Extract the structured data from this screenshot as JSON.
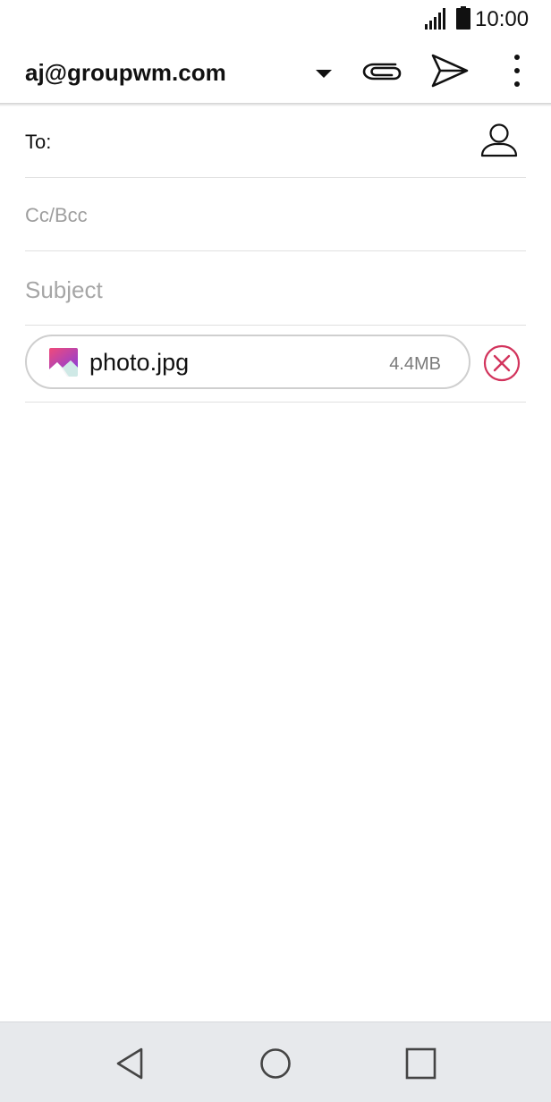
{
  "status_bar": {
    "time": "10:00",
    "signal_icon": "signal-bars-icon",
    "battery_icon": "battery-icon"
  },
  "app_bar": {
    "account": "aj@groupwm.com",
    "icons": [
      "chevron-down-icon",
      "paperclip-icon",
      "send-icon",
      "more-vert-icon"
    ]
  },
  "compose": {
    "to_label": "To:",
    "cc_bcc_label": "Cc/Bcc",
    "subject_placeholder": "Subject",
    "contact_icon": "contact-person-icon"
  },
  "attachment": {
    "filename": "photo.jpg",
    "size": "4.4MB",
    "thumb_icon": "image-file-icon",
    "remove_icon": "remove-circle-icon"
  },
  "nav_bar": {
    "icons": [
      "back-icon",
      "home-icon",
      "recent-apps-icon"
    ]
  },
  "colors": {
    "accent_remove": "#d2335c",
    "divider": "#e0e0e0",
    "placeholder": "#a6a6a6",
    "nav_background": "#e7e9ec"
  }
}
